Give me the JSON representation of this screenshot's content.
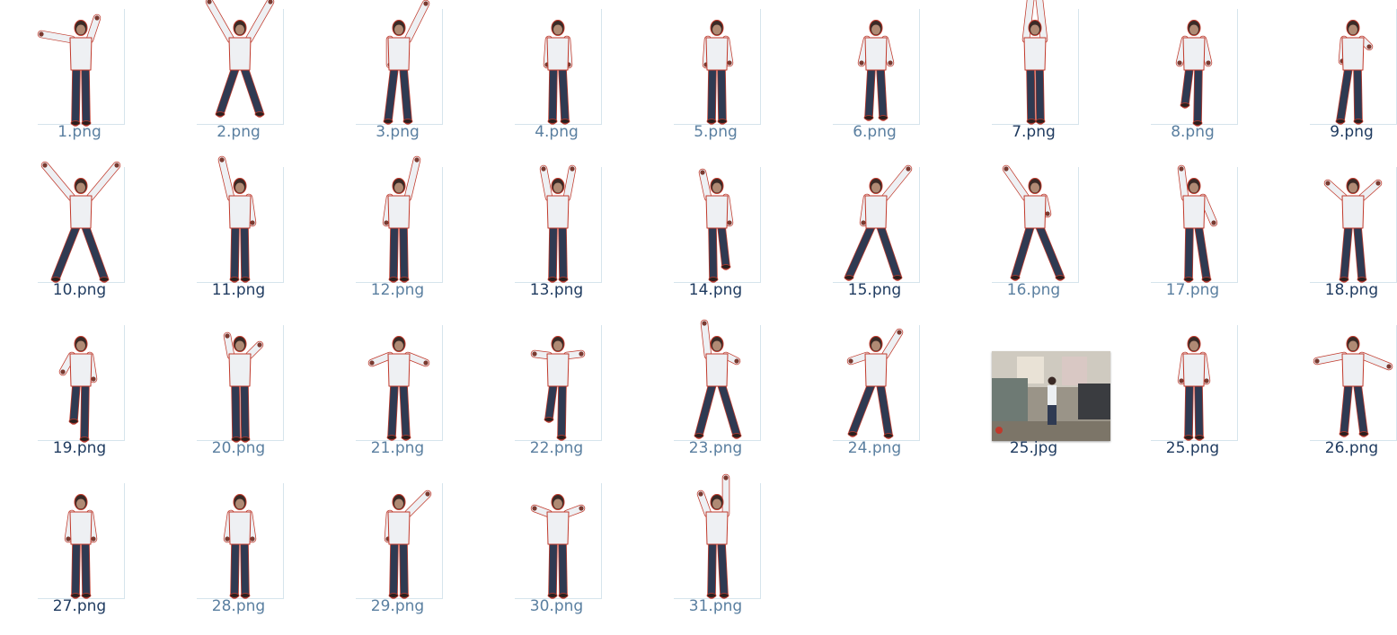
{
  "window": {
    "title": ""
  },
  "files": [
    {
      "name": "1.png"
    },
    {
      "name": "2.png"
    },
    {
      "name": "3.png"
    },
    {
      "name": "4.png"
    },
    {
      "name": "5.png"
    },
    {
      "name": "6.png"
    },
    {
      "name": "7.png"
    },
    {
      "name": "8.png"
    },
    {
      "name": "9.png"
    },
    {
      "name": "10.png"
    },
    {
      "name": "11.png"
    },
    {
      "name": "12.png"
    },
    {
      "name": "13.png"
    },
    {
      "name": "14.png"
    },
    {
      "name": "15.png"
    },
    {
      "name": "16.png"
    },
    {
      "name": "17.png"
    },
    {
      "name": "18.png"
    },
    {
      "name": "19.png"
    },
    {
      "name": "20.png"
    },
    {
      "name": "21.png"
    },
    {
      "name": "22.png"
    },
    {
      "name": "23.png"
    },
    {
      "name": "24.png"
    },
    {
      "name": "25.jpg"
    },
    {
      "name": "25.png"
    },
    {
      "name": "26.png"
    },
    {
      "name": "27.png"
    },
    {
      "name": "28.png"
    },
    {
      "name": "29.png"
    },
    {
      "name": "30.png"
    },
    {
      "name": "31.png"
    }
  ],
  "colors": {
    "label_default": "#5a7fa0",
    "label_dark": "#1e3a5f",
    "outline": "#c0392b",
    "shirt": "#eef0f3",
    "pants": "#2f3a52"
  }
}
